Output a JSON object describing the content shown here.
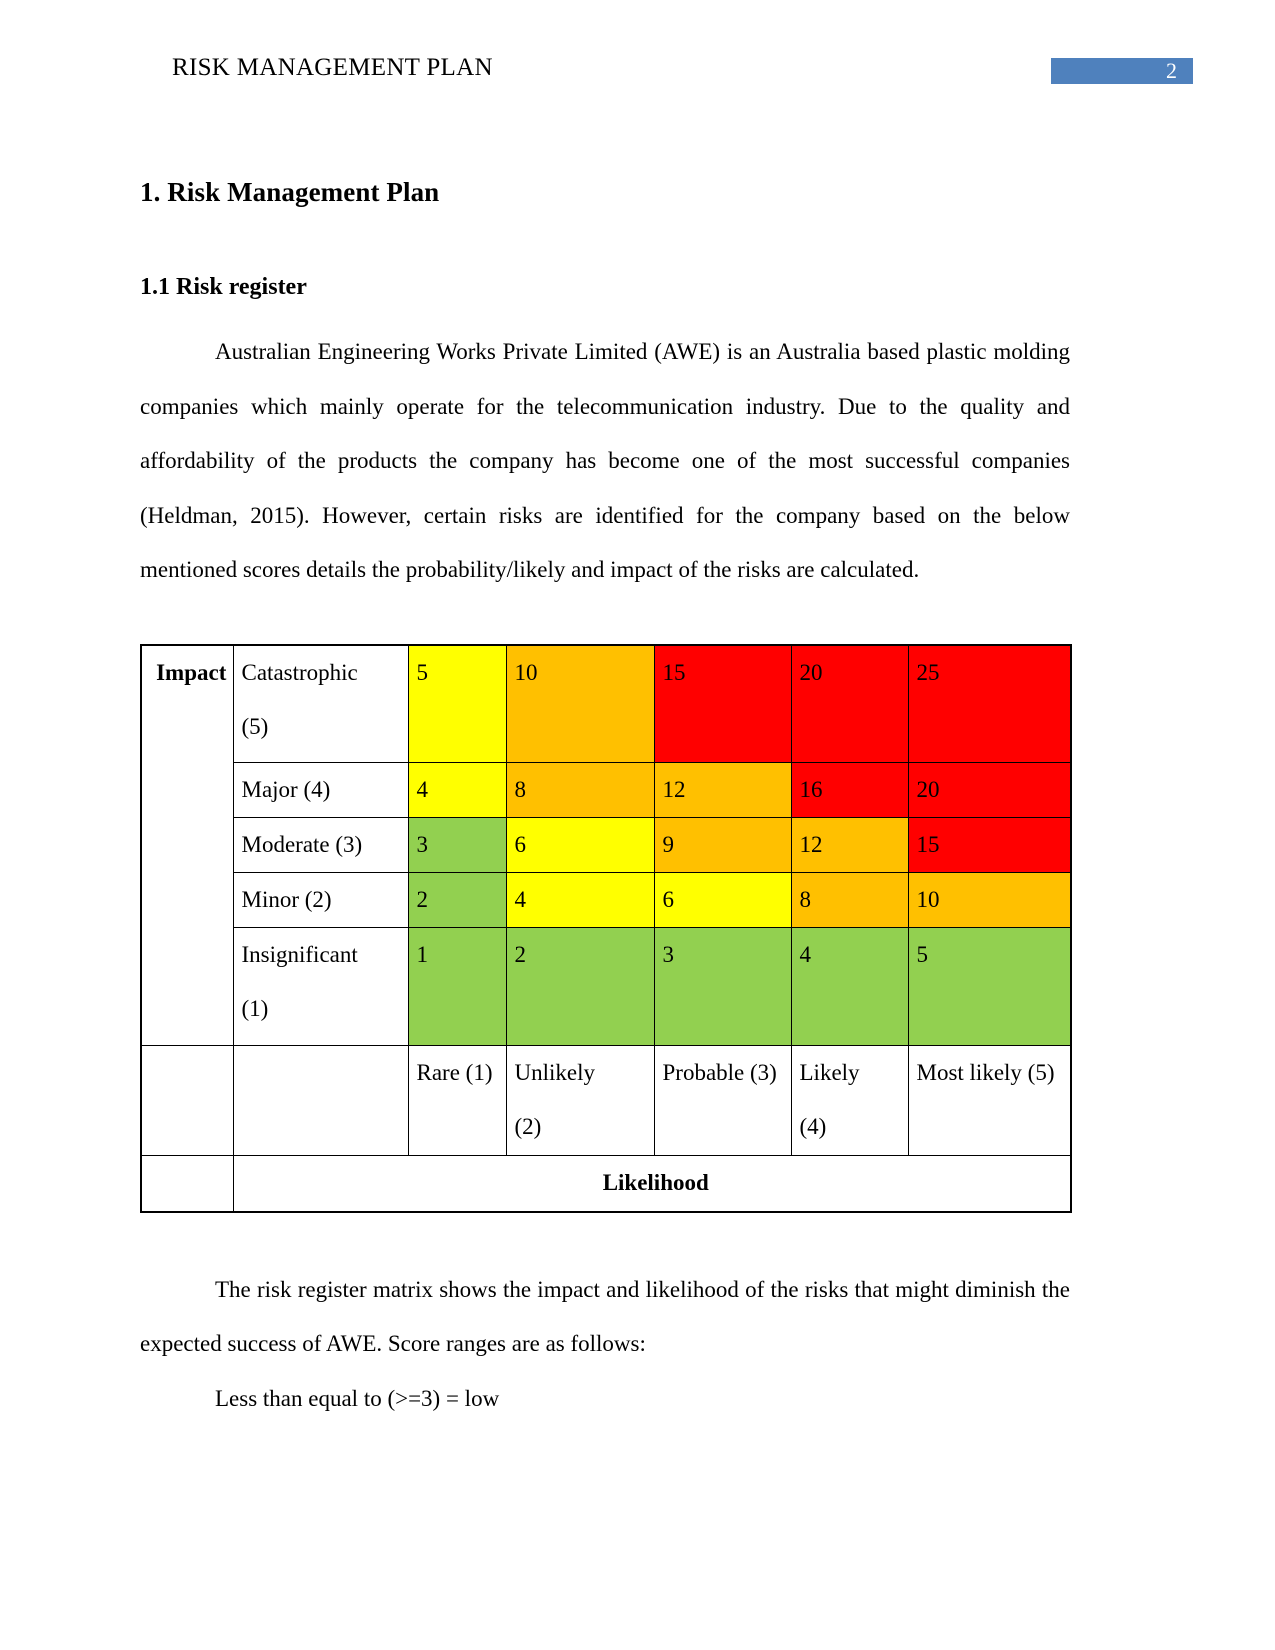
{
  "header": {
    "title": "RISK MANAGEMENT PLAN",
    "page_number": "2",
    "badge_color": "#4F81BD"
  },
  "headings": {
    "h1": "1. Risk Management Plan",
    "h2": "1.1 Risk register"
  },
  "paragraphs": {
    "intro": "Australian Engineering Works Private Limited (AWE) is an Australia based plastic molding companies which mainly operate for the telecommunication industry. Due to the quality and affordability of the products the company has become one of the most successful companies (Heldman, 2015). However, certain risks are identified for the company based on the below mentioned scores details the probability/likely and impact of the risks are calculated.",
    "after_table": "The risk register matrix shows the impact and likelihood of the risks that might diminish the expected success of AWE. Score ranges are as follows:",
    "score_range_low": "Less than equal to (>=3) = low"
  },
  "matrix": {
    "axis_labels": {
      "impact": "Impact",
      "likelihood": "Likelihood"
    },
    "impact_levels": [
      "Catastrophic (5)",
      "Major (4)",
      "Moderate (3)",
      "Minor (2)",
      "Insignificant (1)"
    ],
    "likelihood_levels": [
      "Rare (1)",
      "Unlikely (2)",
      "Probable (3)",
      "Likely (4)",
      "Most likely (5)"
    ],
    "colors": {
      "green": "#92D050",
      "yellow": "#FFFF00",
      "orange": "#FFC000",
      "red": "#FF0000",
      "white": "#FFFFFF"
    }
  },
  "chart_data": {
    "type": "heatmap",
    "title": "Risk register matrix",
    "xlabel": "Likelihood",
    "ylabel": "Impact",
    "x_categories": [
      "Rare (1)",
      "Unlikely (2)",
      "Probable (3)",
      "Likely (4)",
      "Most likely (5)"
    ],
    "y_categories": [
      "Catastrophic (5)",
      "Major (4)",
      "Moderate (3)",
      "Minor (2)",
      "Insignificant (1)"
    ],
    "cells": [
      [
        {
          "value": "5",
          "color": "#FFFF00"
        },
        {
          "value": "10",
          "color": "#FFC000"
        },
        {
          "value": "15",
          "color": "#FF0000"
        },
        {
          "value": "20",
          "color": "#FF0000"
        },
        {
          "value": "25",
          "color": "#FF0000"
        }
      ],
      [
        {
          "value": "4",
          "color": "#FFFF00"
        },
        {
          "value": "8",
          "color": "#FFC000"
        },
        {
          "value": "12",
          "color": "#FFC000"
        },
        {
          "value": "16",
          "color": "#FF0000"
        },
        {
          "value": "20",
          "color": "#FF0000"
        }
      ],
      [
        {
          "value": "3",
          "color": "#92D050"
        },
        {
          "value": "6",
          "color": "#FFFF00"
        },
        {
          "value": "9",
          "color": "#FFC000"
        },
        {
          "value": "12",
          "color": "#FFC000"
        },
        {
          "value": "15",
          "color": "#FF0000"
        }
      ],
      [
        {
          "value": "2",
          "color": "#92D050"
        },
        {
          "value": "4",
          "color": "#FFFF00"
        },
        {
          "value": "6",
          "color": "#FFFF00"
        },
        {
          "value": "8",
          "color": "#FFC000"
        },
        {
          "value": "10",
          "color": "#FFC000"
        }
      ],
      [
        {
          "value": "1",
          "color": "#92D050"
        },
        {
          "value": "2",
          "color": "#92D050"
        },
        {
          "value": "3",
          "color": "#92D050"
        },
        {
          "value": "4",
          "color": "#92D050"
        },
        {
          "value": "5",
          "color": "#92D050"
        }
      ]
    ]
  }
}
